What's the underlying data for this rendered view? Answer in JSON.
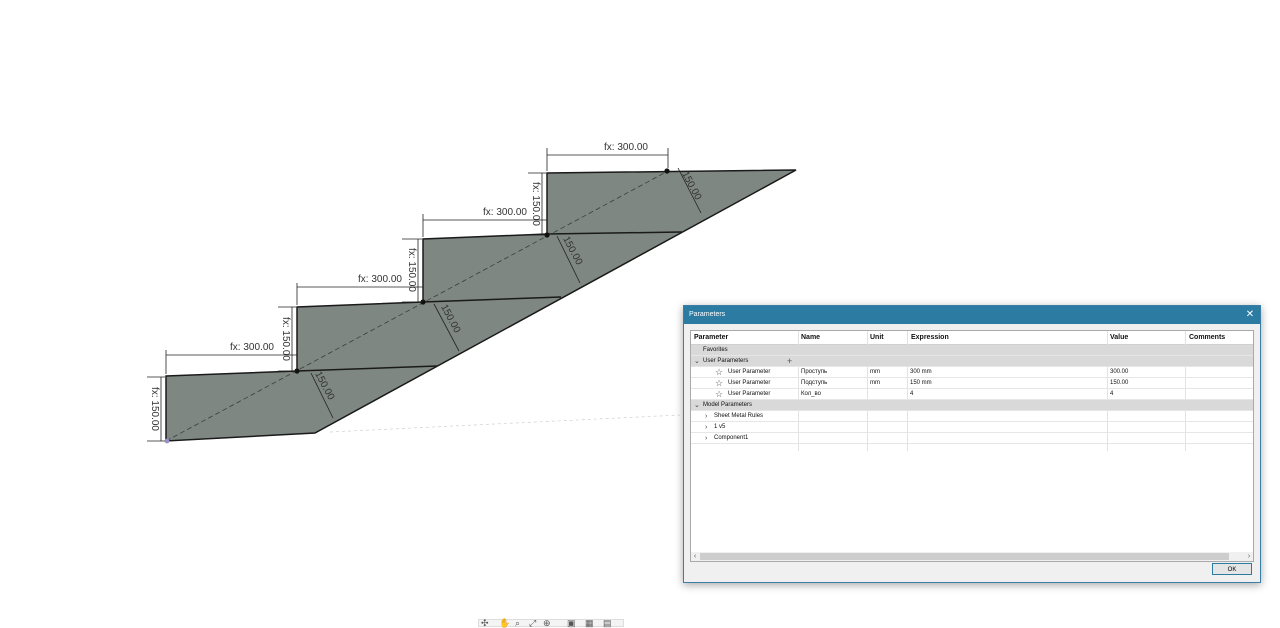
{
  "drawing": {
    "rise_labels": [
      "fx: 150.00",
      "fx: 150.00",
      "fx: 150.00",
      "fx: 150.00"
    ],
    "run_labels": [
      "fx: 300.00",
      "fx: 300.00",
      "fx: 300.00",
      "fx: 300.00"
    ],
    "thickness_labels": [
      "150.00",
      "150.00",
      "150.00",
      "150.00"
    ],
    "colors": {
      "fill": "#7f8782",
      "edge": "#1a1a1a",
      "dim": "#222222",
      "centerline": "#3b3f3c"
    }
  },
  "dialog": {
    "title": "Parameters",
    "columns": [
      "Parameter",
      "Name",
      "Unit",
      "Expression",
      "Value",
      "Comments"
    ],
    "favorites_label": "Favorites",
    "user_params_label": "User Parameters",
    "add_icon": "plus-icon",
    "user_params": [
      {
        "type": "User Parameter",
        "name": "Проступь",
        "unit": "mm",
        "expression": "300 mm",
        "value": "300.00"
      },
      {
        "type": "User Parameter",
        "name": "Подступь",
        "unit": "mm",
        "expression": "150 mm",
        "value": "150.00"
      },
      {
        "type": "User Parameter",
        "name": "Кол_во",
        "unit": "",
        "expression": "4",
        "value": "4"
      }
    ],
    "model_params_label": "Model Parameters",
    "model_params": [
      "Sheet Metal Rules",
      "1 v5",
      "Component1"
    ],
    "ok_label": "OK"
  },
  "toolbar": {
    "icons": [
      "orbit-icon",
      "pan-icon",
      "zoom-window-icon",
      "fit-icon",
      "zoom-icon",
      "display-style-icon",
      "grid-icon",
      "viewports-icon"
    ]
  }
}
